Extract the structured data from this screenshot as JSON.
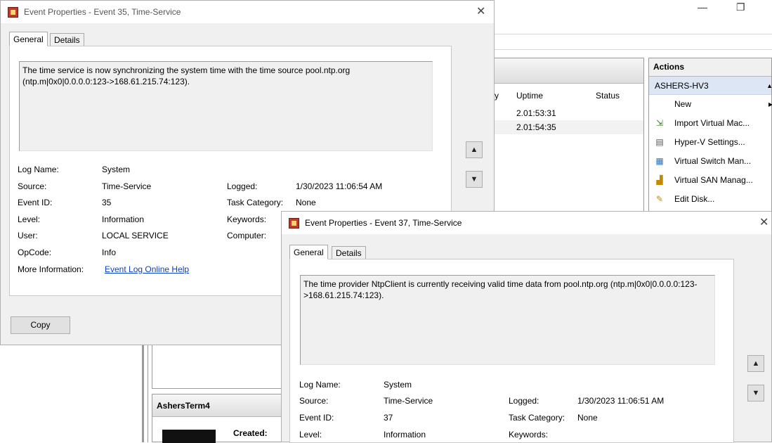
{
  "background": {
    "window_controls": {
      "minimize": "—",
      "restore": "❐"
    },
    "vm_list": {
      "columns": [
        "y",
        "Uptime",
        "Status"
      ],
      "rows": [
        {
          "uptime": "2.01:53:31"
        },
        {
          "uptime": "2.01:54:35"
        }
      ]
    },
    "actions": {
      "title": "Actions",
      "host": "ASHERS-HV3",
      "items": [
        {
          "label": "New",
          "icon": "new-icon"
        },
        {
          "label": "Import Virtual Mac...",
          "icon": "import-icon"
        },
        {
          "label": "Hyper-V Settings...",
          "icon": "settings-icon"
        },
        {
          "label": "Virtual Switch Man...",
          "icon": "switch-icon"
        },
        {
          "label": "Virtual SAN Manag...",
          "icon": "san-icon"
        },
        {
          "label": "Edit Disk...",
          "icon": "edit-disk-icon"
        }
      ]
    },
    "term_panel": {
      "title": "AshersTerm4",
      "created_label": "Created:"
    }
  },
  "dialog1": {
    "title": "Event Properties - Event 35, Time-Service",
    "tabs": [
      "General",
      "Details"
    ],
    "description": "The time service is now synchronizing the system time with the time source pool.ntp.org (ntp.m|0x0|0.0.0.0:123->168.61.215.74:123).",
    "fields": {
      "log_name_label": "Log Name:",
      "log_name": "System",
      "source_label": "Source:",
      "source": "Time-Service",
      "logged_label": "Logged:",
      "logged": "1/30/2023 11:06:54 AM",
      "event_id_label": "Event ID:",
      "event_id": "35",
      "task_category_label": "Task Category:",
      "task_category": "None",
      "level_label": "Level:",
      "level": "Information",
      "keywords_label": "Keywords:",
      "user_label": "User:",
      "user": "LOCAL SERVICE",
      "computer_label": "Computer:",
      "opcode_label": "OpCode:",
      "opcode": "Info",
      "more_info_label": "More Information:",
      "more_info_link": "Event Log Online Help"
    },
    "copy_button": "Copy"
  },
  "dialog2": {
    "title": "Event Properties - Event 37, Time-Service",
    "tabs": [
      "General",
      "Details"
    ],
    "description": "The time provider NtpClient is currently receiving valid time data from pool.ntp.org (ntp.m|0x0|0.0.0.0:123->168.61.215.74:123).",
    "fields": {
      "log_name_label": "Log Name:",
      "log_name": "System",
      "source_label": "Source:",
      "source": "Time-Service",
      "logged_label": "Logged:",
      "logged": "1/30/2023 11:06:51 AM",
      "event_id_label": "Event ID:",
      "event_id": "37",
      "task_category_label": "Task Category:",
      "task_category": "None",
      "level_label": "Level:",
      "level": "Information",
      "keywords_label": "Keywords:"
    }
  }
}
